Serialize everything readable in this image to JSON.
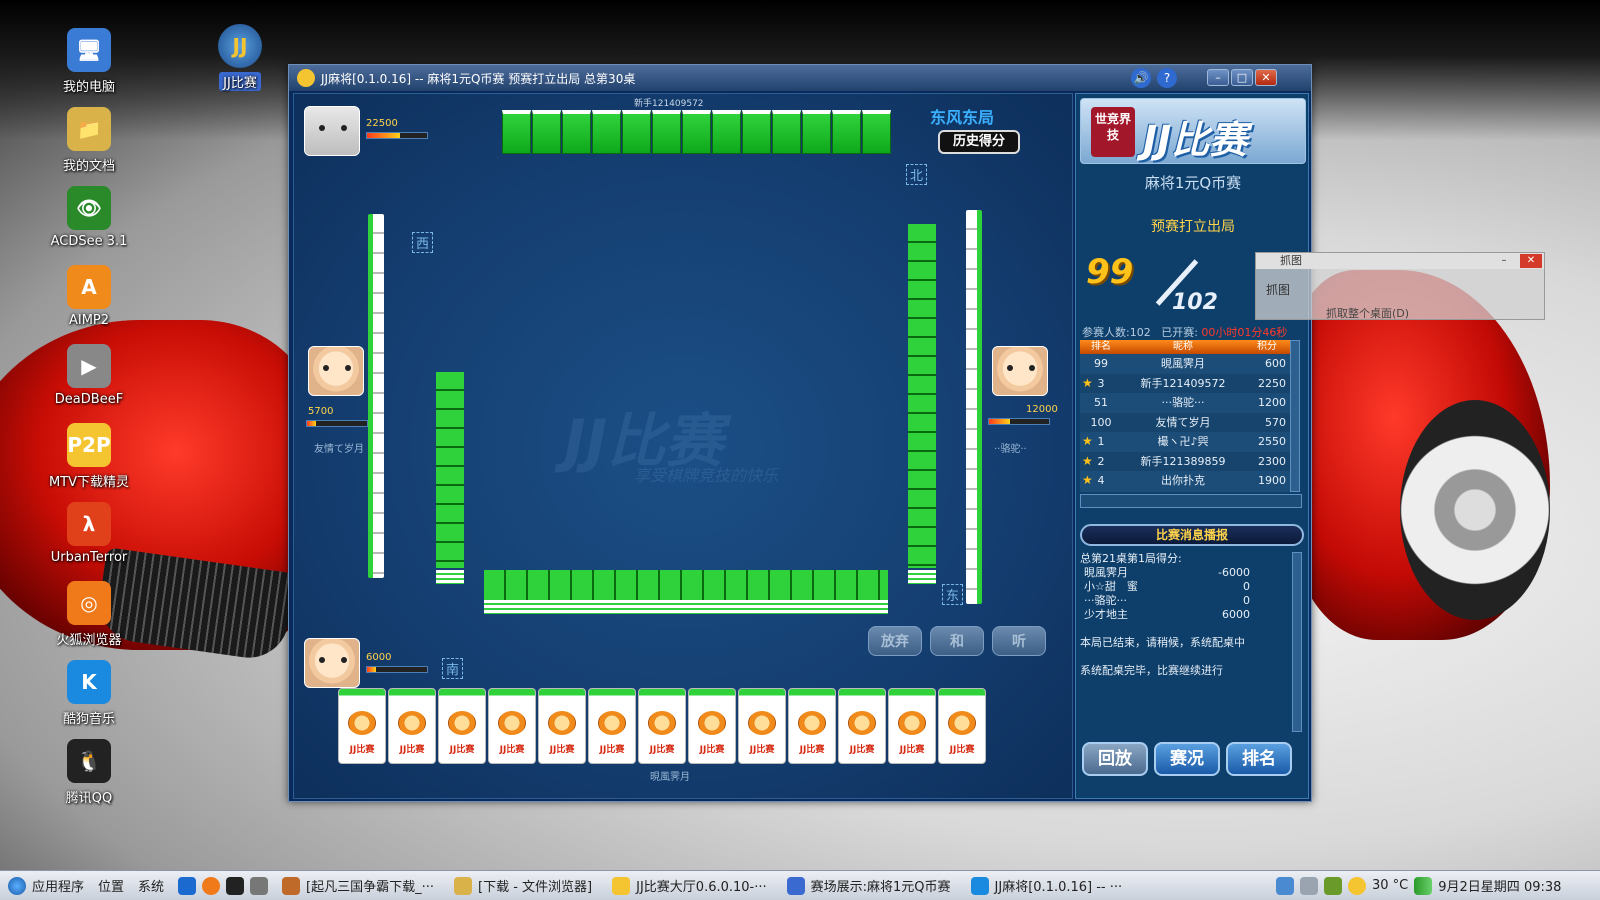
{
  "desktop": {
    "icons": [
      {
        "label": "我的电脑",
        "color": "#3a7bd5",
        "glyph": "🖥"
      },
      {
        "label": "我的文档",
        "color": "#d9b24a",
        "glyph": "📁"
      },
      {
        "label": "ACDSee 3.1",
        "color": "#2a8a2a",
        "glyph": "👁"
      },
      {
        "label": "AIMP2",
        "color": "#f08a1a",
        "glyph": "A"
      },
      {
        "label": "DeaDBeeF",
        "color": "#888888",
        "glyph": "▶"
      },
      {
        "label": "MTV下载精灵",
        "color": "#f4c431",
        "glyph": "P2P"
      },
      {
        "label": "UrbanTerror",
        "color": "#e0401a",
        "glyph": "λ"
      },
      {
        "label": "火狐浏览器",
        "color": "#f07a1a",
        "glyph": "◎"
      },
      {
        "label": "酷狗音乐",
        "color": "#1a8ae0",
        "glyph": "K"
      },
      {
        "label": "腾讯QQ",
        "color": "#222222",
        "glyph": "🐧"
      }
    ],
    "jj_shortcut": {
      "label": "JJ比赛",
      "glyph": "JJ"
    }
  },
  "window": {
    "title": "JJ麻将[0.1.0.16] -- 麻将1元Q币赛 预赛打立出局 总第30桌",
    "controls": {
      "min": "–",
      "max": "□",
      "close": "✕",
      "sound": "🔊",
      "help": "?"
    }
  },
  "board": {
    "round_label": "东风东局",
    "history_button": "历史得分",
    "watermark": "JJ比赛",
    "watermark_sub": "享受棋牌竞技的快乐",
    "top_player": {
      "name": "新手121409572",
      "score": "22500",
      "score_fill": 0.55
    },
    "left_player": {
      "name": "友情て岁月",
      "score": "5700",
      "score_fill": 0.15
    },
    "right_player": {
      "name": "··骆驼··",
      "score": "12000",
      "score_fill": 0.35
    },
    "bottom_player": {
      "name": "晛風霁月",
      "score": "6000",
      "score_fill": 0.15
    },
    "hand_tile_label": "JJ比赛",
    "hand_count": 13,
    "actions": {
      "pass": "放弃",
      "win": "和",
      "ready": "听"
    },
    "seat_marks": {
      "west": "西",
      "north": "北",
      "east": "东",
      "south": "南"
    }
  },
  "panel": {
    "brand_seal": "世竞界技",
    "brand": "JJ比赛",
    "match_name": "麻将1元Q币赛",
    "match_stage": "预赛打立出局",
    "rank": "99",
    "total": "102",
    "participants_label": "参赛人数:102",
    "elapsed_label": "已开赛:",
    "elapsed_value": "00小时01分46秒",
    "table_headers": [
      "排名",
      "昵称",
      "积分"
    ],
    "rank_rows": [
      {
        "rank": "99",
        "name": "晛風霁月",
        "score": "600",
        "star": false
      },
      {
        "rank": "3",
        "name": "新手121409572",
        "score": "2250",
        "star": true
      },
      {
        "rank": "51",
        "name": "···骆驼···",
        "score": "1200",
        "star": false
      },
      {
        "rank": "100",
        "name": "友情て岁月",
        "score": "570",
        "star": false
      },
      {
        "rank": "1",
        "name": "樶ヽ卍♪巺",
        "score": "2550",
        "star": true
      },
      {
        "rank": "2",
        "name": "新手121389859",
        "score": "2300",
        "star": true
      },
      {
        "rank": "4",
        "name": "出你扑克",
        "score": "1900",
        "star": true
      }
    ],
    "news_title": "比赛消息播报",
    "news_heading": "总第21桌第1局得分:",
    "news_scores": [
      {
        "name": "晛風霁月",
        "value": "-6000"
      },
      {
        "name": "小☆甜　蜜",
        "value": "0"
      },
      {
        "name": "···骆驼···",
        "value": "0"
      },
      {
        "name": "少才地主",
        "value": "6000"
      }
    ],
    "news_line1": "本局已结束，请稍候，系统配桌中",
    "news_line2": "系统配桌完毕，比赛继续进行",
    "buttons": {
      "replay": "回放",
      "status": "赛况",
      "ranking": "排名"
    }
  },
  "overlay": {
    "title": "抓图",
    "button": "抓图",
    "hint": "抓取整个桌面(D)",
    "min": "–",
    "close": "✕"
  },
  "taskbar": {
    "menu": [
      "应用程序",
      "位置",
      "系统"
    ],
    "tasks": [
      "[起凡三国争霸下载_···",
      "[下载 - 文件浏览器]",
      "JJ比赛大厅0.6.0.10-···",
      "赛场展示:麻将1元Q币赛",
      "JJ麻将[0.1.0.16] -- ···"
    ],
    "temperature": "30 °C",
    "clock": "9月2日星期四 09:38"
  }
}
